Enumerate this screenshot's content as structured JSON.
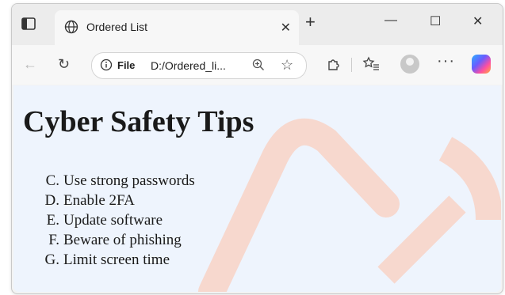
{
  "tab": {
    "title": "Ordered List"
  },
  "address_bar": {
    "file_label": "File",
    "url": "D:/Ordered_li..."
  },
  "page": {
    "heading": "Cyber Safety Tips",
    "items": [
      {
        "marker": "C.",
        "text": "Use strong passwords"
      },
      {
        "marker": "D.",
        "text": "Enable 2FA"
      },
      {
        "marker": "E.",
        "text": "Update software"
      },
      {
        "marker": "F.",
        "text": "Beware of phishing"
      },
      {
        "marker": "G.",
        "text": "Limit screen time"
      }
    ]
  },
  "colors": {
    "content_bg": "#eef4fd",
    "watermark": "#f8d2c6",
    "tab_strip": "#ececec"
  },
  "icons": [
    "tab-actions-icon",
    "globe-icon",
    "close-icon",
    "plus-icon",
    "minimize-icon",
    "maximize-icon",
    "window-close-icon",
    "back-icon",
    "refresh-icon",
    "info-icon",
    "zoom-icon",
    "favorite-star-icon",
    "extensions-icon",
    "favorites-icon",
    "profile-avatar",
    "more-icon",
    "copilot-icon"
  ]
}
